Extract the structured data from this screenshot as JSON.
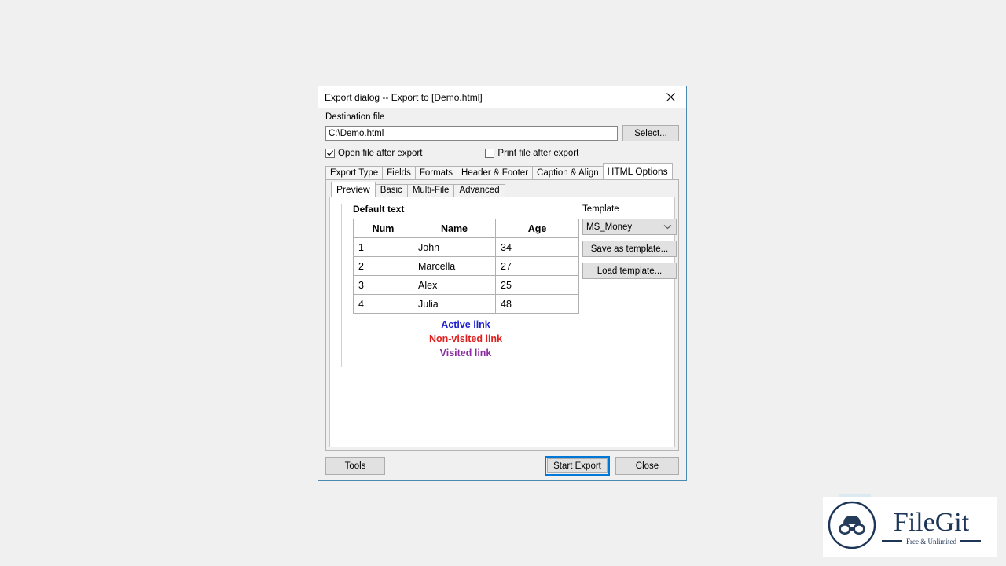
{
  "window": {
    "title": "Export dialog -- Export to [Demo.html]",
    "close_icon": "close-icon"
  },
  "destination": {
    "label": "Destination file",
    "value": "C:\\Demo.html",
    "placeholder": "C:\\Demo.html",
    "select_button": "Select..."
  },
  "options": {
    "open_after_export": {
      "label": "Open file after export",
      "checked": true
    },
    "print_after_export": {
      "label": "Print file after export",
      "checked": false
    }
  },
  "tabs": {
    "items": [
      {
        "label": "Export Type",
        "active": false
      },
      {
        "label": "Fields",
        "active": false
      },
      {
        "label": "Formats",
        "active": false
      },
      {
        "label": "Header & Footer",
        "active": false
      },
      {
        "label": "Caption & Align",
        "active": false
      },
      {
        "label": "HTML Options",
        "active": true
      }
    ]
  },
  "subtabs": {
    "items": [
      {
        "label": "Preview",
        "active": true
      },
      {
        "label": "Basic",
        "active": false
      },
      {
        "label": "Multi-File",
        "active": false
      },
      {
        "label": "Advanced",
        "active": false
      }
    ]
  },
  "preview": {
    "heading": "Default text",
    "table": {
      "columns": [
        "Num",
        "Name",
        "Age"
      ],
      "rows": [
        [
          "1",
          "John",
          "34"
        ],
        [
          "2",
          "Marcella",
          "27"
        ],
        [
          "3",
          "Alex",
          "25"
        ],
        [
          "4",
          "Julia",
          "48"
        ]
      ]
    },
    "links": [
      {
        "text": "Active link",
        "color": "#2020d0"
      },
      {
        "text": "Non-visited link",
        "color": "#e02020"
      },
      {
        "text": "Visited link",
        "color": "#8b2fa0"
      }
    ]
  },
  "template": {
    "label": "Template",
    "selected": "MS_Money",
    "options": [
      "MS_Money"
    ],
    "save_button": "Save as template...",
    "load_button": "Load template..."
  },
  "footer": {
    "tools_button": "Tools",
    "start_button": "Start Export",
    "close_button": "Close"
  },
  "watermark": {
    "name": "FileGit",
    "tagline": "Free & Unlimited",
    "icon": "binoculars-icon",
    "color": "#1d3557"
  }
}
